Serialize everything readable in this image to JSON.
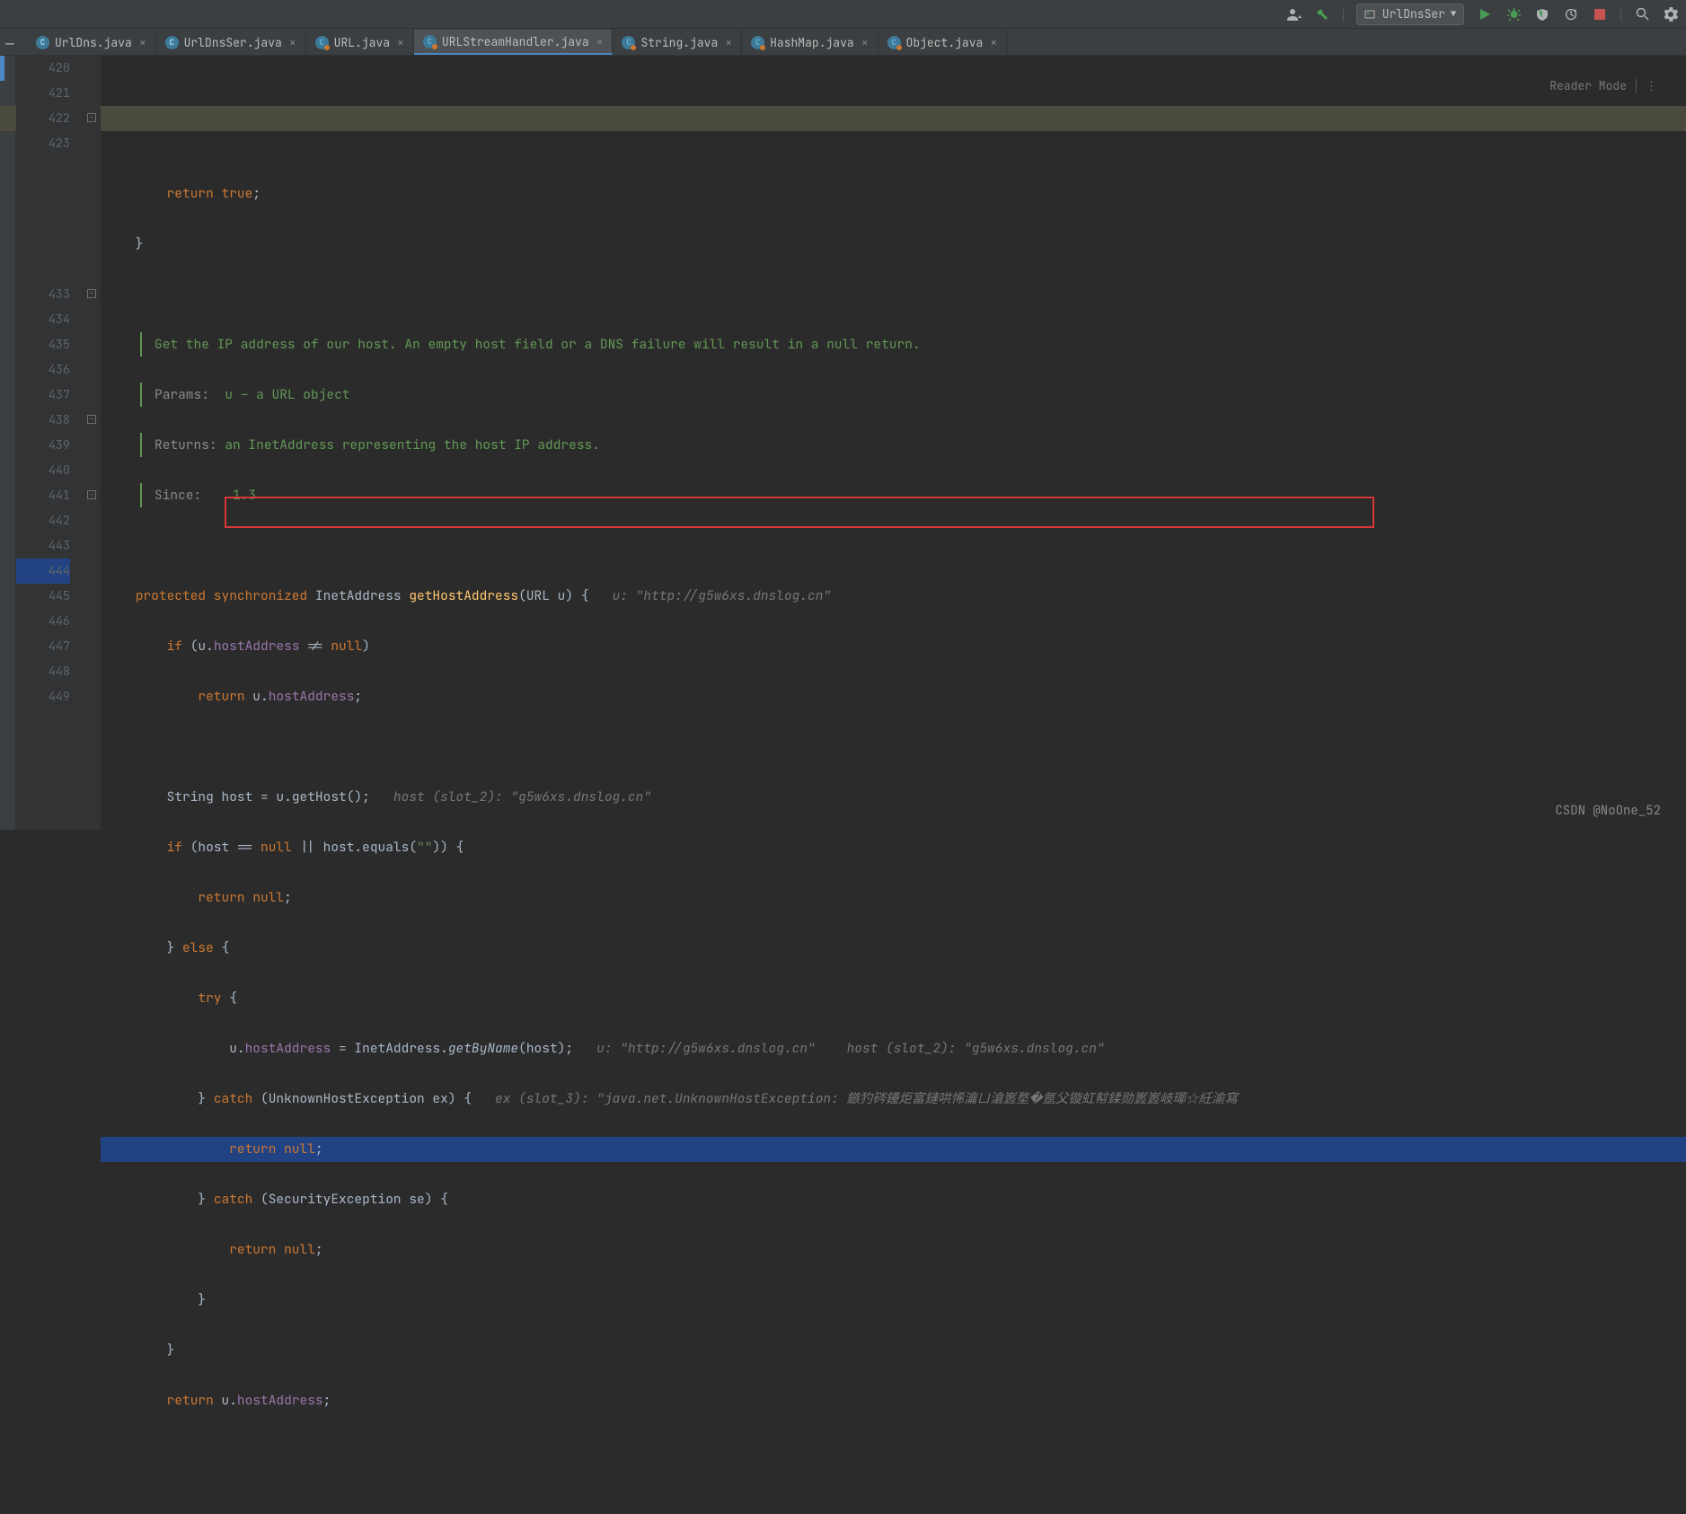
{
  "toolbar": {
    "run_config": "UrlDnsSer"
  },
  "tabs": [
    {
      "label": "UrlDns.java",
      "icon": "java",
      "active": false
    },
    {
      "label": "UrlDnsSer.java",
      "icon": "java",
      "active": false
    },
    {
      "label": "URL.java",
      "icon": "class",
      "active": false
    },
    {
      "label": "URLStreamHandler.java",
      "icon": "class",
      "active": true
    },
    {
      "label": "String.java",
      "icon": "class",
      "active": false
    },
    {
      "label": "HashMap.java",
      "icon": "class",
      "active": false
    },
    {
      "label": "Object.java",
      "icon": "class",
      "active": false
    }
  ],
  "reader_mode_label": "Reader Mode",
  "gutter": [
    "420",
    "421",
    "422",
    "423",
    "",
    "",
    "",
    "",
    "",
    "433",
    "434",
    "435",
    "436",
    "437",
    "438",
    "439",
    "440",
    "441",
    "442",
    "443",
    "444",
    "445",
    "446",
    "447",
    "448",
    "449"
  ],
  "doc": {
    "summary": "Get the IP address of our host. An empty host field or a DNS failure will result in a null return.",
    "params_label": "Params:",
    "params": "u – a URL object",
    "returns_label": "Returns:",
    "returns_pre": "an ",
    "returns_code": "InetAddress",
    "returns_post": " representing the host IP address.",
    "since_label": "Since:",
    "since": "1.3"
  },
  "code": {
    "l420": "",
    "l421_return": "return",
    "l421_true": "true",
    "l433_kw": "protected synchronized",
    "l433_type": "InetAddress",
    "l433_method": "getHostAddress",
    "l433_paramtype": "URL",
    "l433_paramname": "u",
    "l433_hint": "u: \"http://g5w6xs.dnslog.cn\"",
    "l434_if": "if",
    "l434_field": "hostAddress",
    "l434_null": "null",
    "l435_return": "return",
    "l435_field": "hostAddress",
    "l437_type": "String",
    "l437_var": "host",
    "l437_call": "getHost",
    "l437_hint": "host (slot_2): \"g5w6xs.dnslog.cn\"",
    "l438_if": "if",
    "l438_null": "null",
    "l438_equals": "equals",
    "l438_str": "\"\"",
    "l439_return": "return",
    "l439_null": "null",
    "l440_else": "else",
    "l441_try": "try",
    "l442_field": "hostAddress",
    "l442_type": "InetAddress",
    "l442_method": "getByName",
    "l442_hint1": "u: \"http://g5w6xs.dnslog.cn\"",
    "l442_hint2": "host (slot_2): \"g5w6xs.dnslog.cn\"",
    "l443_catch": "catch",
    "l443_ex": "UnknownHostException",
    "l443_var": "ex",
    "l443_hint": "ex (slot_3): \"java.net.UnknownHostException: 鏃犳硶鑸炬富鏈哄悕瀹ㄩ滄嶳堥�氬父镟虹幇鍒勋嶳嶳岐瑘☆紝渝寫",
    "l444_return": "return",
    "l444_null": "null",
    "l445_catch": "catch",
    "l445_ex": "SecurityException",
    "l445_var": "se",
    "l446_return": "return",
    "l446_null": "null",
    "l449_return": "return",
    "l449_field": "hostAddress"
  },
  "watermark": "CSDN @NoOne_52"
}
